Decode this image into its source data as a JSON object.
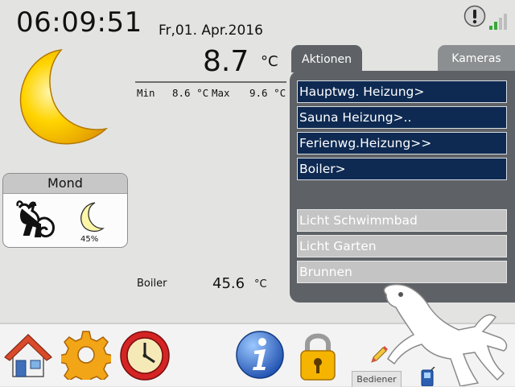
{
  "header": {
    "time": "06:09:51",
    "date": "Fr,01. Apr.2016"
  },
  "weather": {
    "temperature": "8.7",
    "unit": "°C",
    "min_label": "Min",
    "min_value": "8.6 °C",
    "max_label": "Max",
    "max_value": "9.6 °C"
  },
  "moon": {
    "title": "Mond",
    "illumination": "45%",
    "zodiac": "capricorn-icon"
  },
  "boiler": {
    "label": "Boiler",
    "value": "45.6",
    "unit": "°C"
  },
  "tabs": {
    "aktionen": "Aktionen",
    "kameras": "Kameras"
  },
  "actions": {
    "dark": [
      {
        "label": "Hauptwg. Heizung>"
      },
      {
        "label": "Sauna Heizung>.."
      },
      {
        "label": "Ferienwg.Heizung>>"
      },
      {
        "label": "Boiler>"
      }
    ],
    "light": [
      {
        "label": "Licht Schwimmbad"
      },
      {
        "label": "Licht Garten"
      },
      {
        "label": "Brunnen"
      }
    ]
  },
  "bottom": {
    "icons": [
      "home-icon",
      "settings-gear-icon",
      "clock-icon",
      "info-icon",
      "lock-icon",
      "pencil-icon",
      "phone-icon"
    ],
    "bediener": "Bediener"
  },
  "colors": {
    "action_dark": "#0e2a52",
    "action_light": "#c4c4c4",
    "panel": "#5e6266",
    "moon": "#f7c600"
  }
}
